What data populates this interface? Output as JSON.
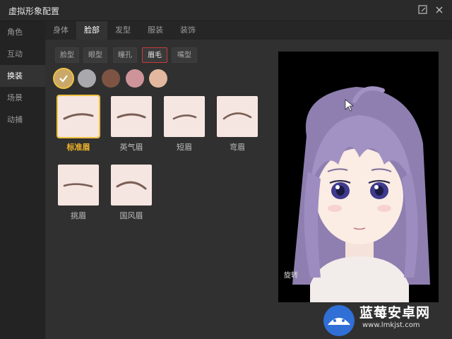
{
  "window": {
    "title": "虚拟形象配置"
  },
  "sidebar": {
    "items": [
      {
        "label": "角色",
        "active": false
      },
      {
        "label": "互动",
        "active": false
      },
      {
        "label": "换装",
        "active": true
      },
      {
        "label": "场景",
        "active": false
      },
      {
        "label": "动捕",
        "active": false
      }
    ]
  },
  "tabs": [
    {
      "label": "身体",
      "active": false
    },
    {
      "label": "脸部",
      "active": true
    },
    {
      "label": "发型",
      "active": false
    },
    {
      "label": "服装",
      "active": false
    },
    {
      "label": "装饰",
      "active": false
    }
  ],
  "subtabs": [
    {
      "label": "脸型",
      "active": false
    },
    {
      "label": "眼型",
      "active": false
    },
    {
      "label": "瞳孔",
      "active": false
    },
    {
      "label": "眉毛",
      "active": true
    },
    {
      "label": "嘴型",
      "active": false
    }
  ],
  "colors": {
    "swatches": [
      "#c9a86a",
      "#a9a8ad",
      "#7d5443",
      "#cf949a",
      "#e3b89e"
    ],
    "selected_index": 0,
    "accent": "#f0b429",
    "active_subtab_border": "#c93a3a"
  },
  "eyebrow_styles": [
    {
      "label": "标准眉",
      "selected": true
    },
    {
      "label": "英气眉",
      "selected": false
    },
    {
      "label": "短眉",
      "selected": false
    },
    {
      "label": "弯眉",
      "selected": false
    },
    {
      "label": "挑眉",
      "selected": false
    },
    {
      "label": "国风眉",
      "selected": false
    }
  ],
  "preview": {
    "overlay_text": "旋转"
  },
  "watermark": {
    "title": "蓝莓安卓网",
    "url": "www.lmkjst.com"
  }
}
